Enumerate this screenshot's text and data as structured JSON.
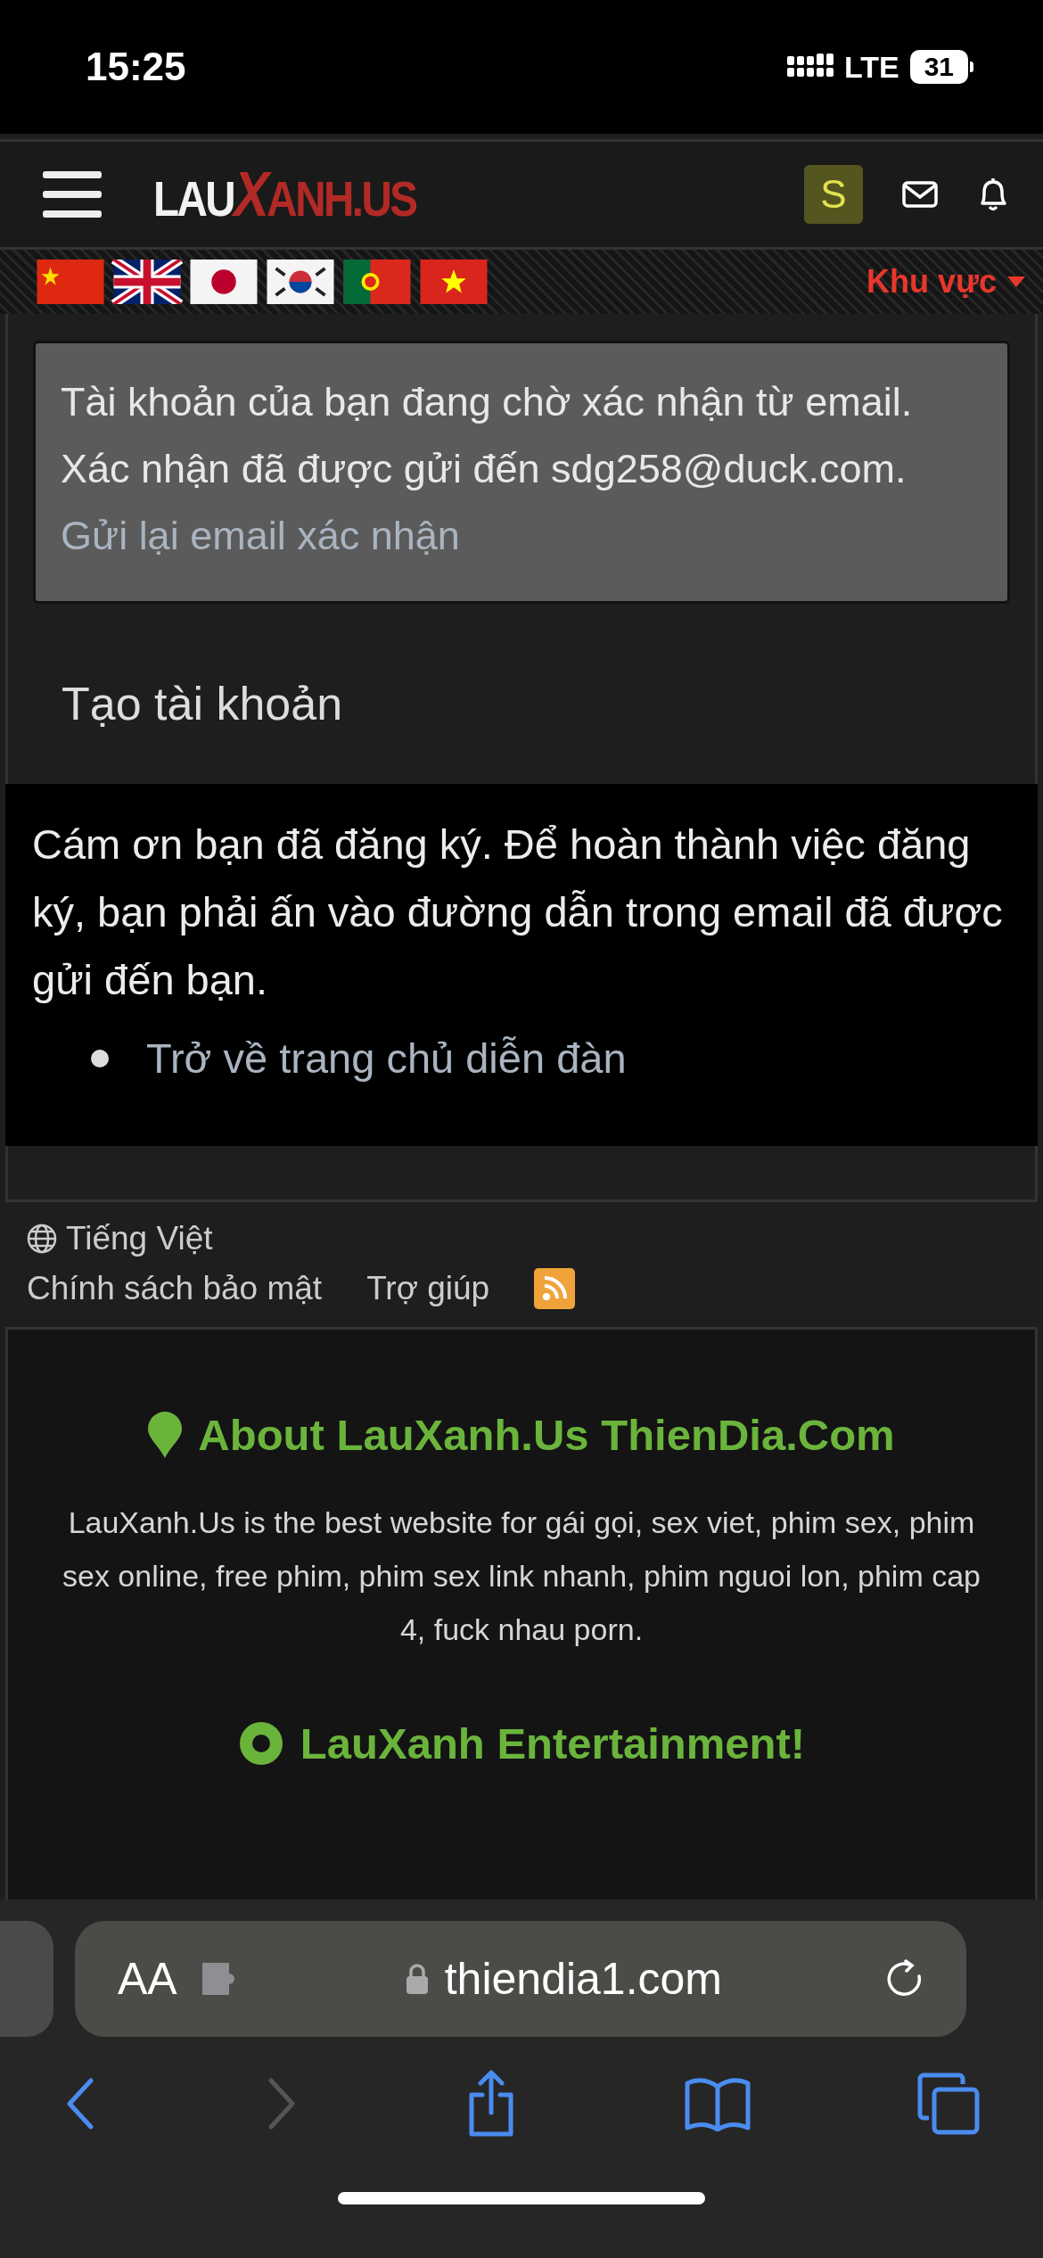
{
  "status_bar": {
    "time": "15:25",
    "network": "LTE",
    "battery": "31"
  },
  "header": {
    "logo_left": "LAU",
    "logo_mid": "X",
    "logo_right": "ANH.US",
    "avatar": "S"
  },
  "flags": [
    {
      "kind": "cn"
    },
    {
      "kind": "gb"
    },
    {
      "kind": "jp"
    },
    {
      "kind": "kr"
    },
    {
      "kind": "pt"
    },
    {
      "kind": "vn"
    }
  ],
  "region_menu": {
    "label": "Khu vực"
  },
  "notice": {
    "text": "Tài khoản của bạn đang chờ xác nhận từ email. Xác nhận đã được gửi đến sdg258@duck.com.",
    "link": "Gửi lại email xác nhận"
  },
  "page_title": "Tạo tài khoản",
  "message": {
    "text": "Cám ơn bạn đã đăng ký. Để hoàn thành việc đăng ký, bạn phải ấn vào đường dẫn trong email đã được gửi đến bạn.",
    "links": [
      "Trở về trang chủ diễn đàn"
    ]
  },
  "footer": {
    "language": "Tiếng Việt",
    "links": [
      "Chính sách bảo mật",
      "Trợ giúp"
    ]
  },
  "about": {
    "title": "About LauXanh.Us ThienDia.Com",
    "text": "LauXanh.Us is the best website for gái gọi, sex viet, phim sex, phim sex online, free phim, phim sex link nhanh, phim nguoi lon, phim cap 4, fuck nhau porn.",
    "next_title": "LauXanh Entertainment!"
  },
  "browser": {
    "text_size": "AA",
    "url": "thiendia1.com"
  }
}
